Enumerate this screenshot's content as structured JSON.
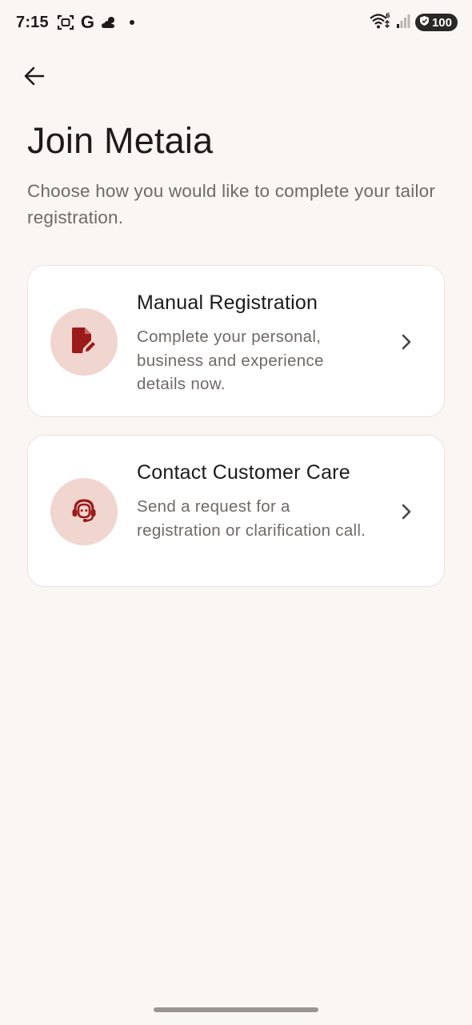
{
  "status_bar": {
    "time": "7:15",
    "google_label": "G",
    "battery_level": "100",
    "icons": [
      "screenshot-icon",
      "google-icon",
      "weather-icon",
      "notification-dot",
      "wifi-icon",
      "signal-icon",
      "battery-shield-icon"
    ]
  },
  "header": {
    "back_icon": "arrow-left-icon",
    "title": "Join Metaia",
    "subtitle": "Choose how you would like to complete your tailor registration."
  },
  "options": [
    {
      "icon": "edit-document-icon",
      "title": "Manual Registration",
      "description": "Complete your personal, business and experience details now."
    },
    {
      "icon": "support-agent-icon",
      "title": "Contact Customer Care",
      "description": "Send a request for a registration or clarification call."
    }
  ],
  "colors": {
    "background": "#faf6f3",
    "card_background": "#ffffff",
    "icon_circle": "#f1d5cf",
    "accent": "#9b1b1b",
    "text_primary": "#1d1b1a",
    "text_secondary": "#6f6a67"
  }
}
